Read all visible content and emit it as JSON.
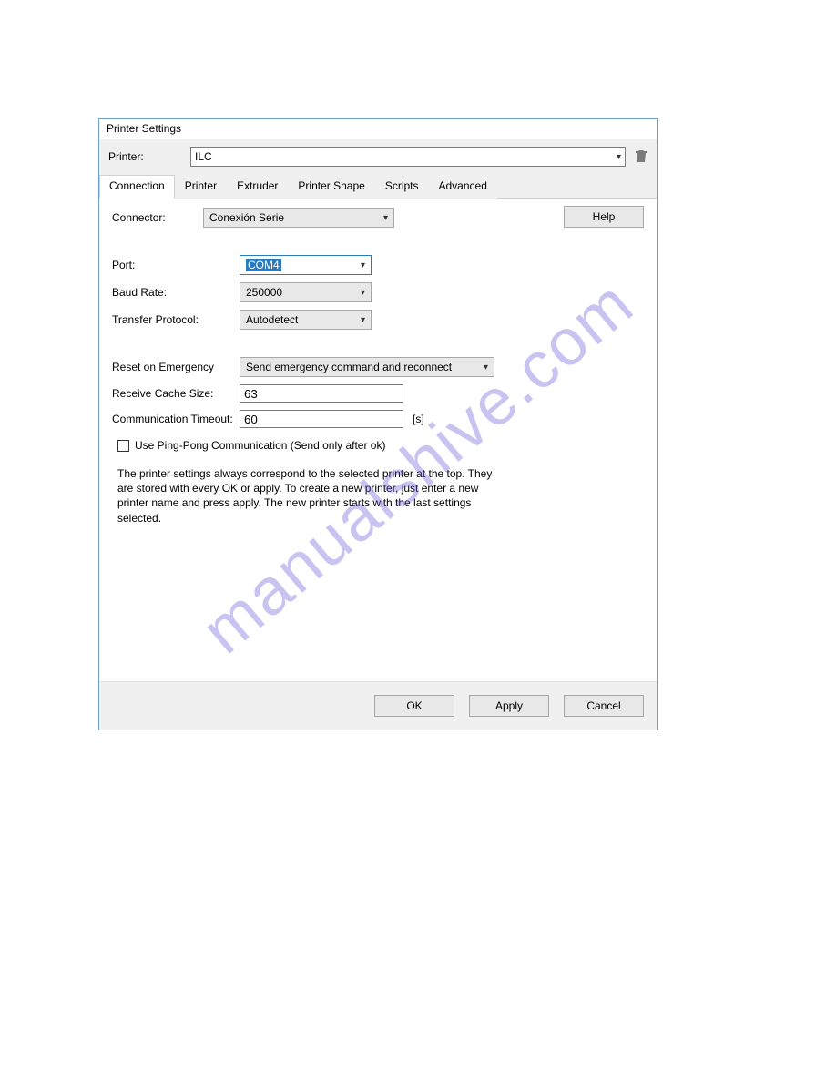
{
  "watermark": "manualshive.com",
  "dialog": {
    "title": "Printer Settings",
    "printer_label": "Printer:",
    "printer_value": "ILC",
    "tabs": [
      "Connection",
      "Printer",
      "Extruder",
      "Printer Shape",
      "Scripts",
      "Advanced"
    ],
    "help": "Help",
    "fields": {
      "connector_label": "Connector:",
      "connector_value": "Conexión Serie",
      "port_label": "Port:",
      "port_value": "COM4",
      "baud_label": "Baud Rate:",
      "baud_value": "250000",
      "transfer_label": "Transfer Protocol:",
      "transfer_value": "Autodetect",
      "reset_label": "Reset on Emergency",
      "reset_value": "Send emergency command and reconnect",
      "cache_label": "Receive Cache Size:",
      "cache_value": "63",
      "timeout_label": "Communication Timeout:",
      "timeout_value": "60",
      "timeout_unit": "[s]",
      "pingpong_label": "Use Ping-Pong Communication (Send only after ok)"
    },
    "info_text": "The printer settings always correspond to the selected printer at the top. They are stored with every OK or apply. To create a new printer, just enter a new printer name and press apply. The new printer starts with the last settings selected.",
    "buttons": {
      "ok": "OK",
      "apply": "Apply",
      "cancel": "Cancel"
    }
  }
}
